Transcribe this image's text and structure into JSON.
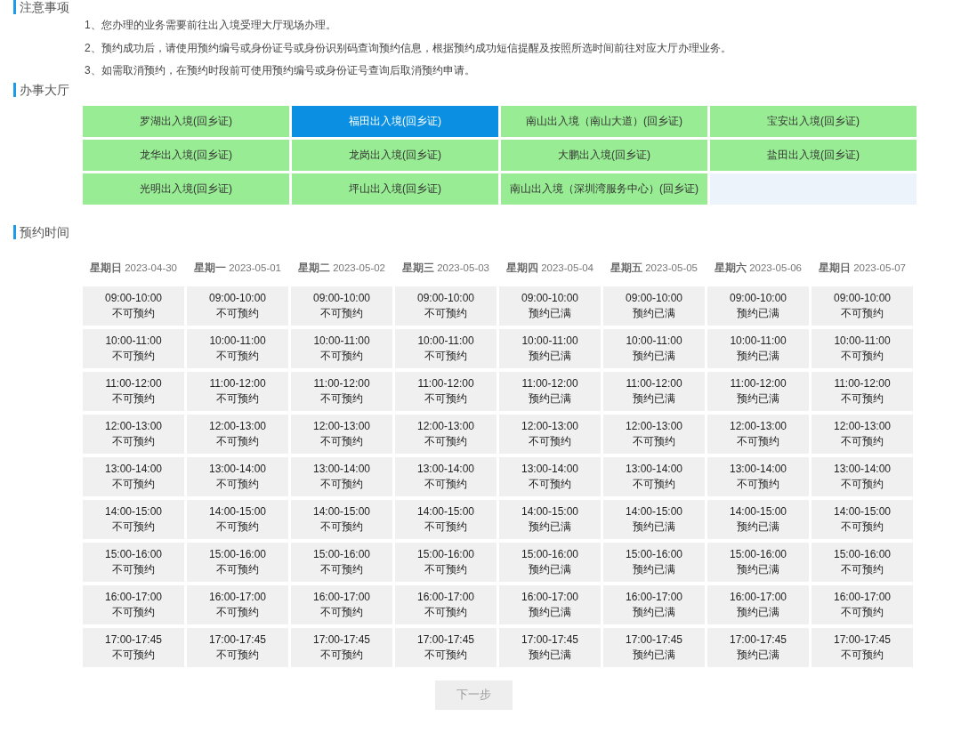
{
  "notice": {
    "title": "注意事项",
    "items": [
      "1、您办理的业务需要前往出入境受理大厅现场办理。",
      "2、预约成功后，请使用预约编号或身份证号或身份识别码查询预约信息，根据预约成功短信提醒及按照所选时间前往对应大厅办理业务。",
      "3、如需取消预约，在预约时段前可使用预约编号或身份证号查询后取消预约申请。"
    ]
  },
  "halls": {
    "title": "办事大厅",
    "items": [
      {
        "label": "罗湖出入境(回乡证)",
        "selected": false
      },
      {
        "label": "福田出入境(回乡证)",
        "selected": true
      },
      {
        "label": "南山出入境（南山大道）(回乡证)",
        "selected": false
      },
      {
        "label": "宝安出入境(回乡证)",
        "selected": false
      },
      {
        "label": "龙华出入境(回乡证)",
        "selected": false
      },
      {
        "label": "龙岗出入境(回乡证)",
        "selected": false
      },
      {
        "label": "大鹏出入境(回乡证)",
        "selected": false
      },
      {
        "label": "盐田出入境(回乡证)",
        "selected": false
      },
      {
        "label": "光明出入境(回乡证)",
        "selected": false
      },
      {
        "label": "坪山出入境(回乡证)",
        "selected": false
      },
      {
        "label": "南山出入境（深圳湾服务中心）(回乡证)",
        "selected": false
      }
    ]
  },
  "schedule": {
    "title": "预约时间",
    "days": [
      {
        "weekday": "星期日",
        "date": "2023-04-30",
        "slots": [
          {
            "time": "09:00-10:00",
            "status": "不可预约"
          },
          {
            "time": "10:00-11:00",
            "status": "不可预约"
          },
          {
            "time": "11:00-12:00",
            "status": "不可预约"
          },
          {
            "time": "12:00-13:00",
            "status": "不可预约"
          },
          {
            "time": "13:00-14:00",
            "status": "不可预约"
          },
          {
            "time": "14:00-15:00",
            "status": "不可预约"
          },
          {
            "time": "15:00-16:00",
            "status": "不可预约"
          },
          {
            "time": "16:00-17:00",
            "status": "不可预约"
          },
          {
            "time": "17:00-17:45",
            "status": "不可预约"
          }
        ]
      },
      {
        "weekday": "星期一",
        "date": "2023-05-01",
        "slots": [
          {
            "time": "09:00-10:00",
            "status": "不可预约"
          },
          {
            "time": "10:00-11:00",
            "status": "不可预约"
          },
          {
            "time": "11:00-12:00",
            "status": "不可预约"
          },
          {
            "time": "12:00-13:00",
            "status": "不可预约"
          },
          {
            "time": "13:00-14:00",
            "status": "不可预约"
          },
          {
            "time": "14:00-15:00",
            "status": "不可预约"
          },
          {
            "time": "15:00-16:00",
            "status": "不可预约"
          },
          {
            "time": "16:00-17:00",
            "status": "不可预约"
          },
          {
            "time": "17:00-17:45",
            "status": "不可预约"
          }
        ]
      },
      {
        "weekday": "星期二",
        "date": "2023-05-02",
        "slots": [
          {
            "time": "09:00-10:00",
            "status": "不可预约"
          },
          {
            "time": "10:00-11:00",
            "status": "不可预约"
          },
          {
            "time": "11:00-12:00",
            "status": "不可预约"
          },
          {
            "time": "12:00-13:00",
            "status": "不可预约"
          },
          {
            "time": "13:00-14:00",
            "status": "不可预约"
          },
          {
            "time": "14:00-15:00",
            "status": "不可预约"
          },
          {
            "time": "15:00-16:00",
            "status": "不可预约"
          },
          {
            "time": "16:00-17:00",
            "status": "不可预约"
          },
          {
            "time": "17:00-17:45",
            "status": "不可预约"
          }
        ]
      },
      {
        "weekday": "星期三",
        "date": "2023-05-03",
        "slots": [
          {
            "time": "09:00-10:00",
            "status": "不可预约"
          },
          {
            "time": "10:00-11:00",
            "status": "不可预约"
          },
          {
            "time": "11:00-12:00",
            "status": "不可预约"
          },
          {
            "time": "12:00-13:00",
            "status": "不可预约"
          },
          {
            "time": "13:00-14:00",
            "status": "不可预约"
          },
          {
            "time": "14:00-15:00",
            "status": "不可预约"
          },
          {
            "time": "15:00-16:00",
            "status": "不可预约"
          },
          {
            "time": "16:00-17:00",
            "status": "不可预约"
          },
          {
            "time": "17:00-17:45",
            "status": "不可预约"
          }
        ]
      },
      {
        "weekday": "星期四",
        "date": "2023-05-04",
        "slots": [
          {
            "time": "09:00-10:00",
            "status": "预约已满"
          },
          {
            "time": "10:00-11:00",
            "status": "预约已满"
          },
          {
            "time": "11:00-12:00",
            "status": "预约已满"
          },
          {
            "time": "12:00-13:00",
            "status": "不可预约"
          },
          {
            "time": "13:00-14:00",
            "status": "不可预约"
          },
          {
            "time": "14:00-15:00",
            "status": "预约已满"
          },
          {
            "time": "15:00-16:00",
            "status": "预约已满"
          },
          {
            "time": "16:00-17:00",
            "status": "预约已满"
          },
          {
            "time": "17:00-17:45",
            "status": "预约已满"
          }
        ]
      },
      {
        "weekday": "星期五",
        "date": "2023-05-05",
        "slots": [
          {
            "time": "09:00-10:00",
            "status": "预约已满"
          },
          {
            "time": "10:00-11:00",
            "status": "预约已满"
          },
          {
            "time": "11:00-12:00",
            "status": "预约已满"
          },
          {
            "time": "12:00-13:00",
            "status": "不可预约"
          },
          {
            "time": "13:00-14:00",
            "status": "不可预约"
          },
          {
            "time": "14:00-15:00",
            "status": "预约已满"
          },
          {
            "time": "15:00-16:00",
            "status": "预约已满"
          },
          {
            "time": "16:00-17:00",
            "status": "预约已满"
          },
          {
            "time": "17:00-17:45",
            "status": "预约已满"
          }
        ]
      },
      {
        "weekday": "星期六",
        "date": "2023-05-06",
        "slots": [
          {
            "time": "09:00-10:00",
            "status": "预约已满"
          },
          {
            "time": "10:00-11:00",
            "status": "预约已满"
          },
          {
            "time": "11:00-12:00",
            "status": "预约已满"
          },
          {
            "time": "12:00-13:00",
            "status": "不可预约"
          },
          {
            "time": "13:00-14:00",
            "status": "不可预约"
          },
          {
            "time": "14:00-15:00",
            "status": "预约已满"
          },
          {
            "time": "15:00-16:00",
            "status": "预约已满"
          },
          {
            "time": "16:00-17:00",
            "status": "预约已满"
          },
          {
            "time": "17:00-17:45",
            "status": "预约已满"
          }
        ]
      },
      {
        "weekday": "星期日",
        "date": "2023-05-07",
        "slots": [
          {
            "time": "09:00-10:00",
            "status": "不可预约"
          },
          {
            "time": "10:00-11:00",
            "status": "不可预约"
          },
          {
            "time": "11:00-12:00",
            "status": "不可预约"
          },
          {
            "time": "12:00-13:00",
            "status": "不可预约"
          },
          {
            "time": "13:00-14:00",
            "status": "不可预约"
          },
          {
            "time": "14:00-15:00",
            "status": "不可预约"
          },
          {
            "time": "15:00-16:00",
            "status": "不可预约"
          },
          {
            "time": "16:00-17:00",
            "status": "不可预约"
          },
          {
            "time": "17:00-17:45",
            "status": "不可预约"
          }
        ]
      }
    ]
  },
  "next_button": {
    "label": "下一步",
    "disabled": true
  }
}
